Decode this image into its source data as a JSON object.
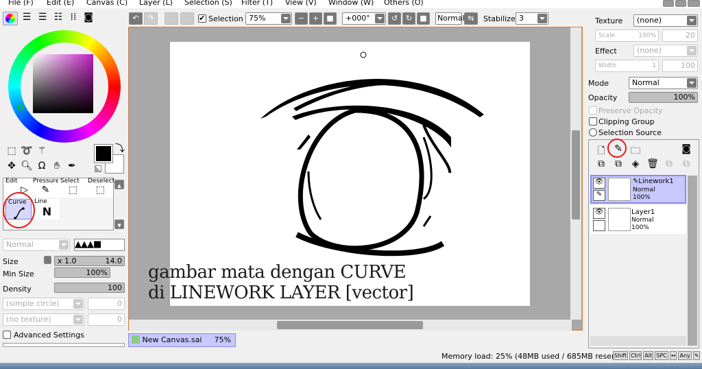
{
  "menu": [
    "File (F)",
    "Edit (E)",
    "Canvas (C)",
    "Layer (L)",
    "Selection (S)",
    "Filter (T)",
    "View (V)",
    "Window (W)",
    "Others (O)"
  ],
  "toolbar": {
    "selection_label": "Selection",
    "selection_checked": true,
    "zoom": "75%",
    "rotation": "+000°",
    "blend": "Normal",
    "stabilizer_label": "Stabilizer",
    "stabilizer": "3"
  },
  "tools": {
    "row1": [
      "Edit",
      "Pressure",
      "Select",
      "Deselect"
    ],
    "row2": [
      "Curve",
      "Line"
    ],
    "selected": "Curve"
  },
  "brush": {
    "mode": "Normal",
    "size_label": "Size",
    "size_mult": "x 1.0",
    "size": "14.0",
    "min_size_label": "Min Size",
    "min_size": "100%",
    "density_label": "Density",
    "density": "100",
    "shape": "(simple circle)",
    "shape_val": "0",
    "texture": "(no texture)",
    "texture_val": "0",
    "advanced": "Advanced Settings"
  },
  "right": {
    "texture_label": "Texture",
    "texture": "(none)",
    "scale_label": "Scale",
    "scale": "100%",
    "scale2": "20",
    "effect_label": "Effect",
    "effect": "(none)",
    "width_label": "Width",
    "width": "1",
    "width2": "100",
    "mode_label": "Mode",
    "mode": "Normal",
    "opacity_label": "Opacity",
    "opacity": "100%",
    "preserve": "Preserve Opacity",
    "clipping": "Clipping Group",
    "selsource": "Selection Source"
  },
  "layers": [
    {
      "name": "Linework1",
      "mode": "Normal",
      "opacity": "100%",
      "selected": true
    },
    {
      "name": "Layer1",
      "mode": "Normal",
      "opacity": "100%",
      "selected": false
    }
  ],
  "canvas": {
    "caption1": "gambar mata dengan CURVE",
    "caption2": "di LINEWORK LAYER [vector]"
  },
  "tab": {
    "name": "New Canvas.sai",
    "zoom": "75%"
  },
  "status": {
    "memory": "Memory load: 25% (48MB used / 685MB reserved)",
    "keys": [
      "Shift",
      "Ctrl",
      "Alt",
      "SPC",
      "↔",
      "Any",
      "✎"
    ]
  },
  "colors": {
    "accent": "#c8c8ff",
    "highlight": "#e81818",
    "canvas_bg": "#a8a8a8"
  }
}
